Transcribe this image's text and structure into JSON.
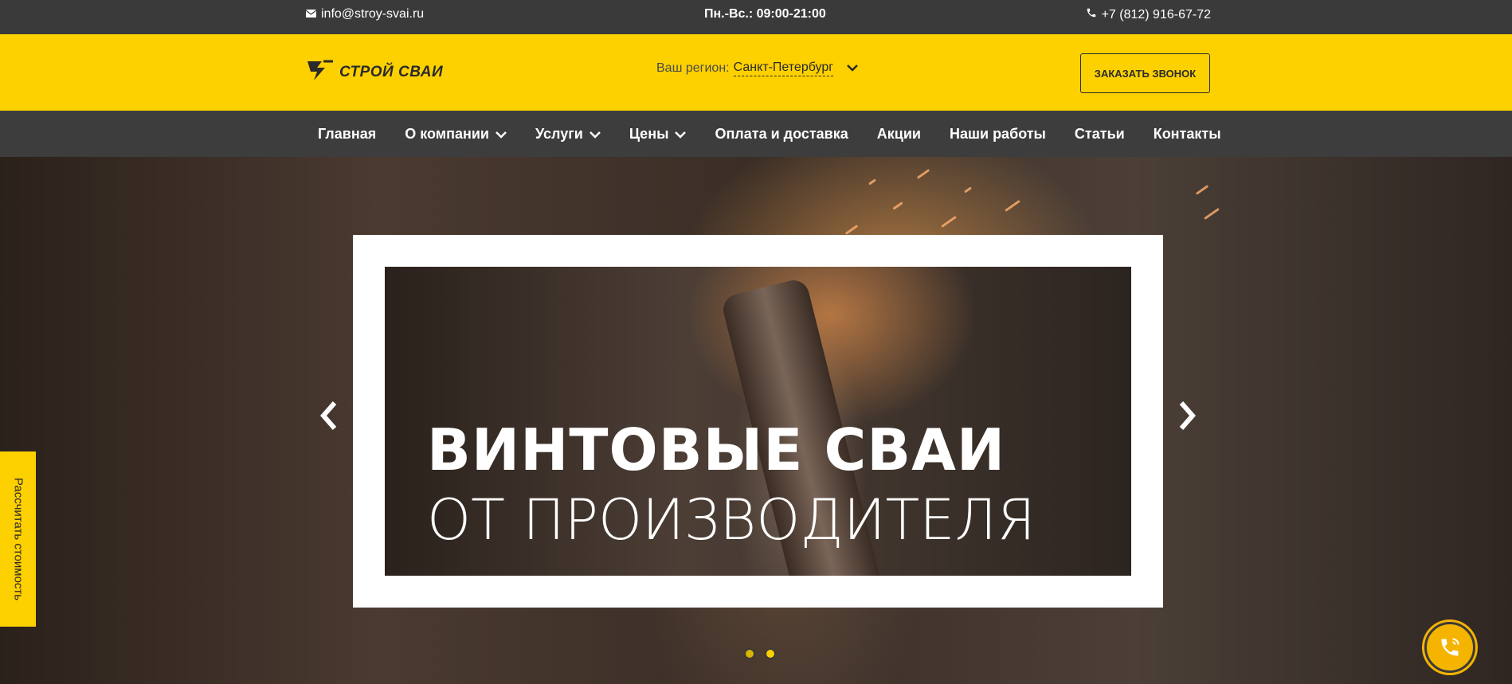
{
  "topbar": {
    "email": "info@stroy-svai.ru",
    "hours": "Пн.-Вс.: 09:00-21:00",
    "phone": "+7 (812) 916-67-72"
  },
  "header": {
    "logo_text": "СТРОЙ СВАИ",
    "region_label": "Ваш регион:",
    "region_city": "Санкт-Петербург",
    "call_button": "ЗАКАЗАТЬ ЗВОНОК"
  },
  "nav": {
    "items": [
      {
        "label": "Главная",
        "has_dropdown": false
      },
      {
        "label": "О компании",
        "has_dropdown": true
      },
      {
        "label": "Услуги",
        "has_dropdown": true
      },
      {
        "label": "Цены",
        "has_dropdown": true
      },
      {
        "label": "Оплата и доставка",
        "has_dropdown": false
      },
      {
        "label": "Акции",
        "has_dropdown": false
      },
      {
        "label": "Наши работы",
        "has_dropdown": false
      },
      {
        "label": "Статьи",
        "has_dropdown": false
      },
      {
        "label": "Контакты",
        "has_dropdown": false
      }
    ]
  },
  "hero": {
    "title": "ВИНТОВЫЕ СВАИ",
    "subtitle": "ОТ ПРОИЗВОДИТЕЛЯ",
    "slides_count": 2,
    "active_slide": 1
  },
  "side_tab": {
    "label": "Рассчитать стоимость"
  },
  "colors": {
    "brand_yellow": "#fdd000",
    "dark_bar": "#3a3a3a",
    "nav_bg": "#3d3d3d"
  }
}
